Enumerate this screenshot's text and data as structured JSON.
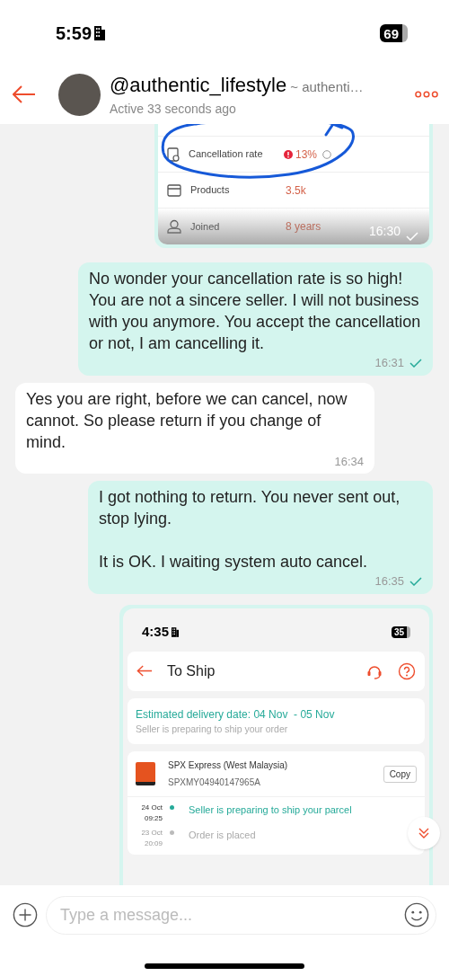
{
  "status_bar": {
    "time": "5:59",
    "battery": "69"
  },
  "header": {
    "username": "@authentic_lifestyle",
    "subtitle": "~ authenti…",
    "status": "Active 33 seconds ago"
  },
  "messages": [
    {
      "kind": "image",
      "outgoing": true,
      "time": "16:30",
      "read": true,
      "screenshot": {
        "kind": "shop_stats",
        "rows": [
          {
            "label": "Cancellation rate",
            "value": "13%",
            "alert": true,
            "circled": true
          },
          {
            "label": "Products",
            "value": "3.5k",
            "alert": false,
            "circled": false
          },
          {
            "label": "Joined",
            "value": "8 years",
            "alert": false,
            "circled": false
          }
        ]
      }
    },
    {
      "kind": "text",
      "outgoing": true,
      "text": "No wonder your cancellation rate is so high! You are not a sincere seller. I will not business with you anymore. You accept the cancellation or not, I am cancelling it.",
      "time": "16:31",
      "read": true
    },
    {
      "kind": "text",
      "outgoing": false,
      "text": "Yes you are right, before we can cancel, now cannot. So please return if you change of mind.",
      "time": "16:34"
    },
    {
      "kind": "text",
      "outgoing": true,
      "text": "I got nothing to return. You never sent out, stop lying.\n\nIt is OK. I waiting system auto cancel.",
      "time": "16:35",
      "read": true
    },
    {
      "kind": "image",
      "outgoing": true,
      "screenshot": {
        "kind": "order_status",
        "status_bar": {
          "time": "4:35",
          "battery": "35"
        },
        "title": "To Ship",
        "estimate": "Estimated delivery date: 04 Nov  - 05 Nov",
        "estimate_note": "Seller is preparing to ship your order",
        "courier": "SPX Express (West Malaysia)",
        "tracking": "SPXMY04940147965A",
        "copy_button": "Copy",
        "timeline": [
          {
            "date": "24 Oct",
            "time": "09:25",
            "text": "Seller is preparing to ship your parcel",
            "current": true
          },
          {
            "date": "23 Oct",
            "time": "20:09",
            "text": "Order is placed",
            "current": false
          }
        ]
      }
    }
  ],
  "input": {
    "placeholder": "Type a message..."
  }
}
